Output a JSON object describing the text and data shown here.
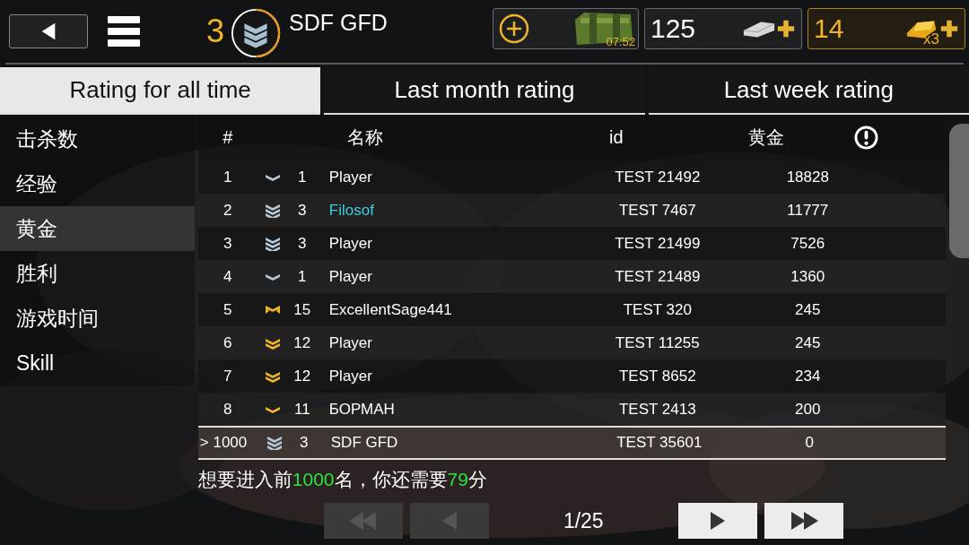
{
  "header": {
    "level": "3",
    "player_name": "SDF GFD",
    "crate_timer": "07:52",
    "silver": "125",
    "gold": "14",
    "gold_multiplier": "x3"
  },
  "tabs": [
    {
      "label": "Rating for all time",
      "selected": true
    },
    {
      "label": "Last month rating",
      "selected": false
    },
    {
      "label": "Last week rating",
      "selected": false
    }
  ],
  "sidebar": {
    "items": [
      {
        "label": "击杀数",
        "selected": false
      },
      {
        "label": "经验",
        "selected": false
      },
      {
        "label": "黄金",
        "selected": true
      },
      {
        "label": "胜利",
        "selected": false
      },
      {
        "label": "游戏时间",
        "selected": false
      },
      {
        "label": "Skill",
        "selected": false
      }
    ]
  },
  "table": {
    "columns": [
      "#",
      "名称",
      "id",
      "黄金"
    ],
    "rows": [
      {
        "rank": "1",
        "badge": {
          "kind": "single",
          "color": "#b8c8d6"
        },
        "level": "1",
        "name": "Player",
        "highlighted": false,
        "id": "TEST 21492",
        "gold": "18828"
      },
      {
        "rank": "2",
        "badge": {
          "kind": "triple",
          "color": "#b8c8d6"
        },
        "level": "3",
        "name": "Filosof",
        "highlighted": true,
        "id": "TEST 7467",
        "gold": "11777"
      },
      {
        "rank": "3",
        "badge": {
          "kind": "triple",
          "color": "#b8c8d6"
        },
        "level": "3",
        "name": "Player",
        "highlighted": false,
        "id": "TEST 21499",
        "gold": "7526"
      },
      {
        "rank": "4",
        "badge": {
          "kind": "single",
          "color": "#b8c8d6"
        },
        "level": "1",
        "name": "Player",
        "highlighted": false,
        "id": "TEST 21489",
        "gold": "1360"
      },
      {
        "rank": "5",
        "badge": {
          "kind": "winged",
          "color": "#f0b428"
        },
        "level": "15",
        "name": "ExcellentSage441",
        "highlighted": false,
        "id": "TEST 320",
        "gold": "245"
      },
      {
        "rank": "6",
        "badge": {
          "kind": "double",
          "color": "#f0b428"
        },
        "level": "12",
        "name": "Player",
        "highlighted": false,
        "id": "TEST 11255",
        "gold": "245"
      },
      {
        "rank": "7",
        "badge": {
          "kind": "double",
          "color": "#f0b428"
        },
        "level": "12",
        "name": "Player",
        "highlighted": false,
        "id": "TEST 8652",
        "gold": "234"
      },
      {
        "rank": "8",
        "badge": {
          "kind": "single",
          "color": "#f0b428"
        },
        "level": "11",
        "name": "БОРМАН",
        "highlighted": false,
        "id": "TEST 2413",
        "gold": "200"
      }
    ],
    "own_row": {
      "rank": "> 1000",
      "badge": {
        "kind": "triple",
        "color": "#b8c8d6"
      },
      "level": "3",
      "name": "SDF GFD",
      "id": "TEST 35601",
      "gold": "0"
    }
  },
  "message": [
    {
      "text": "想要进入前",
      "highlight": false
    },
    {
      "text": "1000",
      "highlight": true
    },
    {
      "text": "名，你还需要",
      "highlight": false
    },
    {
      "text": "79",
      "highlight": true
    },
    {
      "text": "分",
      "highlight": false
    }
  ],
  "pager": {
    "page": "1/25",
    "buttons": [
      {
        "kind": "first",
        "disabled": true
      },
      {
        "kind": "prev",
        "disabled": true
      },
      {
        "kind": "next",
        "disabled": false
      },
      {
        "kind": "last",
        "disabled": false
      }
    ]
  }
}
